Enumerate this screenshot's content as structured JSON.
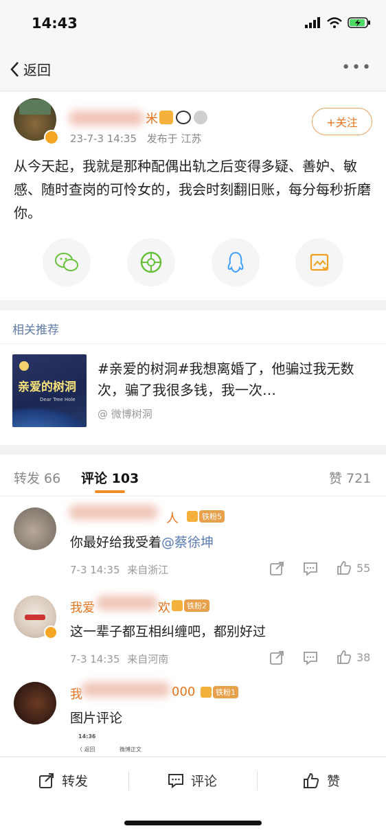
{
  "status_bar": {
    "time": "14:43"
  },
  "nav": {
    "back_label": "返回",
    "more_label": "•••"
  },
  "post": {
    "username_tail": "米",
    "timestamp": "23-7-3 14:35",
    "location": "发布于 江苏",
    "follow_label": "+关注",
    "text": "从今天起，我就是那种配偶出轨之后变得多疑、善妒、敏感、随时查岗的可怜女的，我会时刻翻旧账，每分每秒折磨你。",
    "share_icons": [
      "wechat-icon",
      "moments-icon",
      "qq-icon",
      "save-image-icon"
    ]
  },
  "related": {
    "heading": "相关推荐",
    "thumb_title": "亲爱的树洞",
    "thumb_sub": "Dear Tree Hole",
    "text": "#亲爱的树洞#我想离婚了，他骗过我无数次，骗了我很多钱，我一次…",
    "source": "@ 微博树洞"
  },
  "tabs": {
    "repost": "转发 66",
    "comment": "评论 103",
    "like": "赞 721"
  },
  "comments": [
    {
      "name_tail": "人",
      "badge": "铁粉5",
      "text_plain": "你最好给我受着",
      "mention": "@蔡徐坤",
      "time": "7-3 14:35",
      "location": "来自浙江",
      "likes": "55"
    },
    {
      "name_head": "我爱",
      "name_tail": "欢",
      "badge": "铁粉2",
      "text_plain": "这一辈子都互相纠缠吧，都别好过",
      "mention": "",
      "time": "7-3 14:35",
      "location": "来自河南",
      "likes": "38"
    },
    {
      "name_head": "我",
      "name_tail": "000",
      "badge": "铁粉1",
      "text_plain": "图片评论",
      "mention": ""
    }
  ],
  "mini_preview": {
    "time": "14:36",
    "back": "〈 返回",
    "title": "微博正文"
  },
  "bottom_bar": {
    "repost": "转发",
    "comment": "评论",
    "like": "赞"
  },
  "colors": {
    "accent": "#e8731d",
    "link": "#5a7bb5"
  }
}
